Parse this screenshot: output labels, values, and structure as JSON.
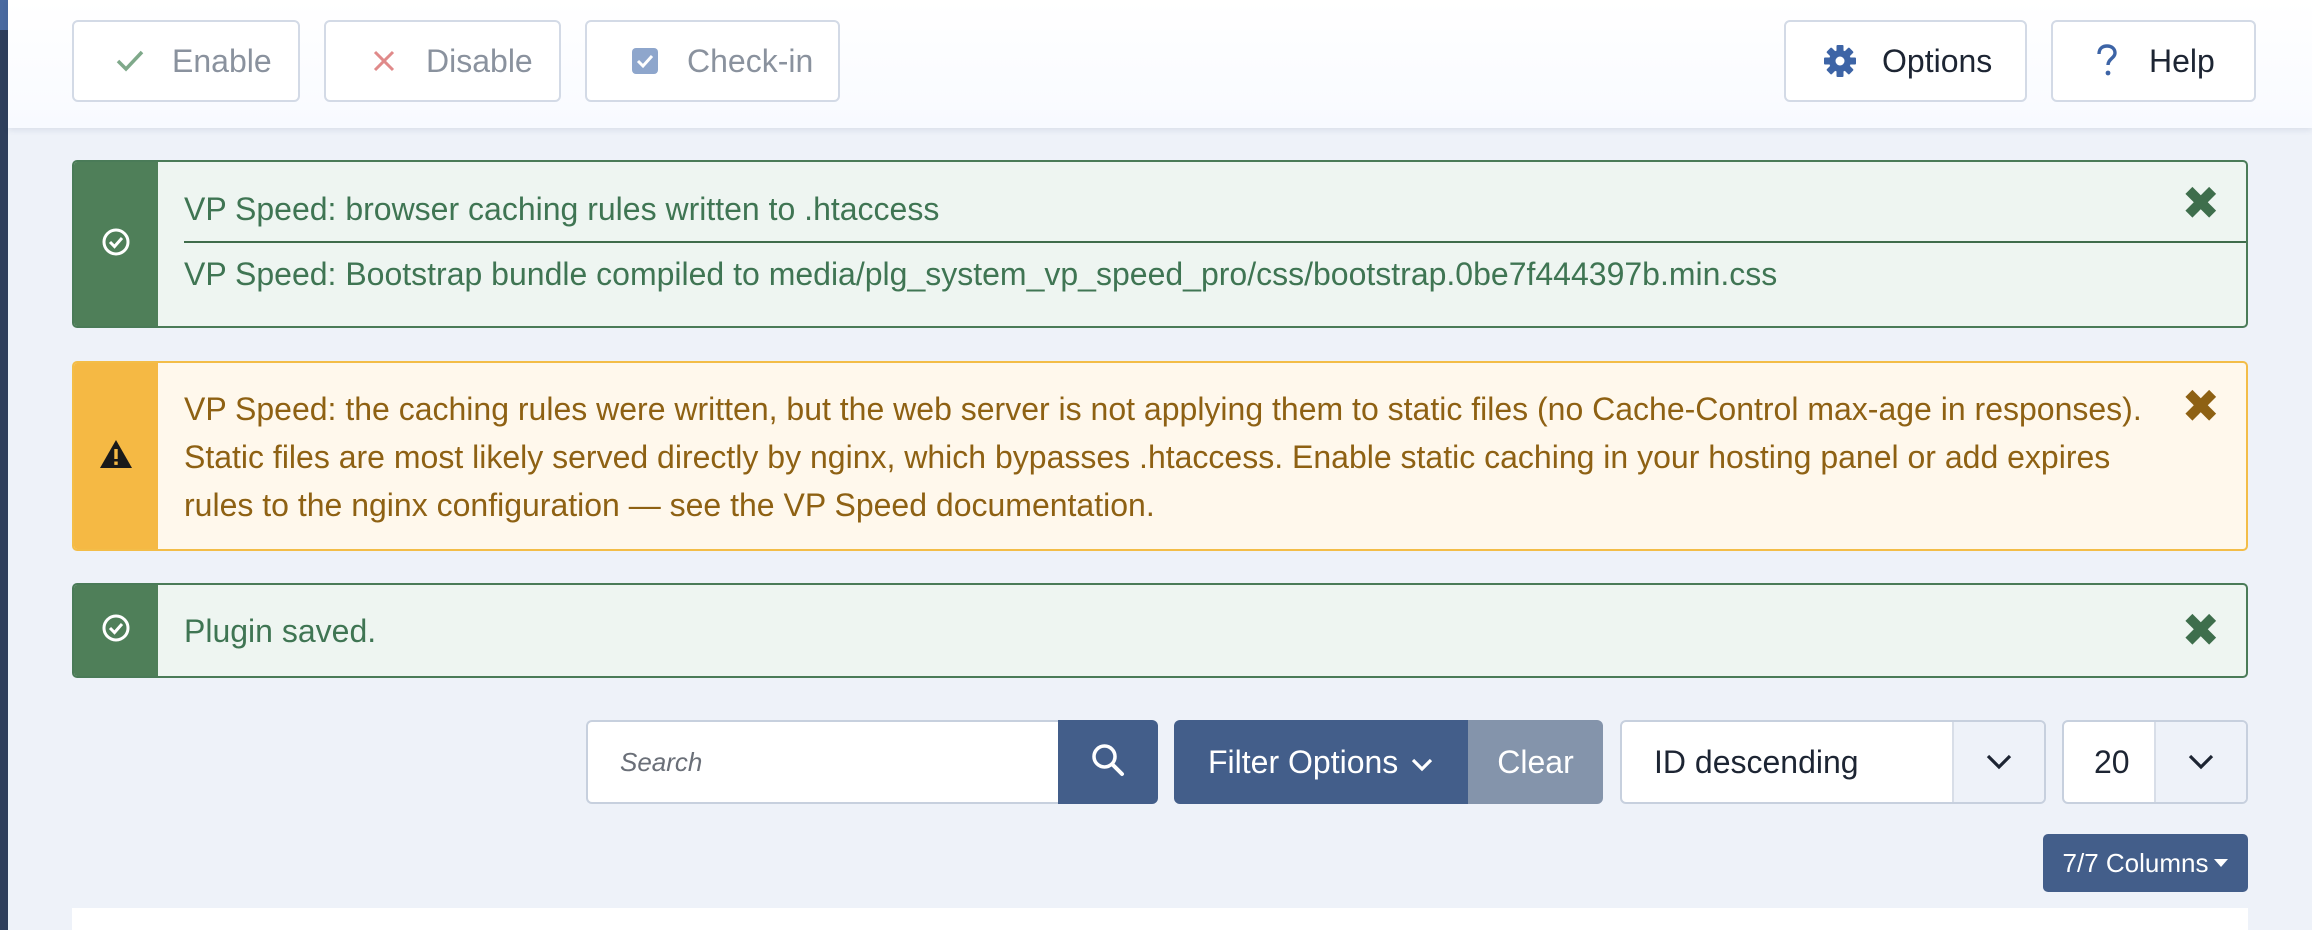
{
  "toolbar": {
    "enable_label": "Enable",
    "disable_label": "Disable",
    "checkin_label": "Check-in",
    "options_label": "Options",
    "help_label": "Help"
  },
  "alerts": [
    {
      "type": "success",
      "icon": "check-circle-icon",
      "messages": [
        "VP Speed: browser caching rules written to .htaccess",
        "VP Speed: Bootstrap bundle compiled to media/plg_system_vp_speed_pro/css/bootstrap.0be7f444397b.min.css"
      ]
    },
    {
      "type": "warning",
      "icon": "warning-triangle-icon",
      "messages": [
        "VP Speed: the caching rules were written, but the web server is not applying them to static files (no Cache-Control max-age in responses). Static files are most likely served directly by nginx, which bypasses .htaccess. Enable static caching in your hosting panel or add expires rules to the nginx configuration — see the VP Speed documentation."
      ]
    },
    {
      "type": "success",
      "icon": "check-circle-icon",
      "messages": [
        "Plugin saved."
      ]
    }
  ],
  "filters": {
    "search_placeholder": "Search",
    "filter_options_label": "Filter Options",
    "clear_label": "Clear",
    "sort_value": "ID descending",
    "limit_value": "20",
    "columns_label": "7/7 Columns"
  },
  "colors": {
    "primary": "#435e8a",
    "success": "#4f7f59",
    "warning": "#f5b944",
    "background": "#eef2f9"
  }
}
